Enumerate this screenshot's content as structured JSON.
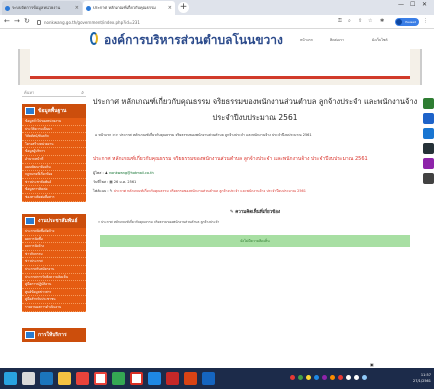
{
  "browser": {
    "tabs": [
      {
        "label": "ระบบจัดการข้อมูลหน่วยงาน"
      },
      {
        "label": "ประกาศ หลักเกณฑ์เกี่ยวกับคุณธรรม"
      }
    ],
    "url": "nonkwang.go.th/government/index.php?id=231",
    "profile_label": "Paused"
  },
  "site": {
    "title": "องค์การบริหารส่วนตำบลโนนขวาง",
    "nav": [
      "หน้าแรก",
      "ติดต่อเรา",
      "ผังเว็บไซต์"
    ]
  },
  "sidebar": {
    "search_placeholder": "ค้นหา",
    "box1": {
      "title": "ข้อมูลพื้นฐาน",
      "items": [
        "ข้อมูลทั่วไปของหน่วยงาน",
        "ประวัติความเป็นมา",
        "วิสัยทัศน์/พันธกิจ",
        "โครงสร้างหน่วยงาน",
        "ข้อมูลผู้บริหาร",
        "อำนาจหน้าที่",
        "แผนพัฒนาท้องถิ่น",
        "กฎหมายที่เกี่ยวข้อง",
        "ข่าวประชาสัมพันธ์",
        "ข้อมูลการติดต่อ",
        "ช่องทางติดต่อสื่อสาร"
      ]
    },
    "box2": {
      "title": "งานประชาสัมพันธ์",
      "items": [
        "ประกาศจัดซื้อจัดจ้าง",
        "ผลการจัดซื้อ",
        "ผลการจัดจ้าง",
        "ข่าวกิจกรรม",
        "ข่าวประกาศ",
        "ประกาศรับสมัครงาน",
        "ประกาศการรับฟังความคิดเห็น",
        "คู่มือการปฏิบัติงาน",
        "ศูนย์ข้อมูลข่าวสาร",
        "คู่มือสำหรับประชาชน",
        "รายงานผลการดำเนินงาน"
      ]
    },
    "box3": {
      "title": "การให้บริการ"
    }
  },
  "content": {
    "title": "ประกาศ หลักเกณฑ์เกี่ยวกับคุณธรรม จริยธรรมของพนักงานส่วนตำบล ลูกจ้างประจำ และพนักงานจ้าง ประจำปีงบประมาณ 2561",
    "breadcrumb": "หน้าแรก >> ประกาศ หลักเกณฑ์เกี่ยวกับคุณธรรม จริยธรรมของพนักงานส่วนตำบล ลูกจ้างประจำ และพนักงานจ้าง ประจำปีงบประมาณ 2561",
    "doc_line": "ประกาศ หลักเกณฑ์เกี่ยวกับคุณธรรม จริยธรรมของพนักงานส่วนตำบล ลูกจ้างประจำ และพนักงานจ้าง ประจำปีงบประมาณ 2561",
    "meta": {
      "by_label": "ผู้โพส :",
      "by_value": "nonkwang@hotmail.co.th",
      "date_label": "วันที่โพส :",
      "date_value": "26 ม.ค. 2561",
      "file_label": "ไฟล์แนบ :",
      "file_value": "ประกาศ หลักเกณฑ์เกี่ยวกับคุณธรรม จริยธรรมของพนักงานส่วนตำบล ลูกจ้างประจำ และพนักงานจ้าง ประจำปีงบประมาณ 2561"
    },
    "comments_head": "ความคิดเห็นที่เกี่ยวข้อง",
    "comment_row": "ประกาศ หลักเกณฑ์เกี่ยวกับคุณธรรม จริยธรรมของพนักงานส่วนตำบล ลูกจ้างประจำ",
    "green_bar": "ยังไม่มีความคิดเห็น"
  },
  "taskbar": {
    "time": "11:57",
    "date": "27/1/2561"
  },
  "colors": {
    "sidebar": "#e55c12",
    "taskbar": "#1c2b4a",
    "title": "#2b4a8b"
  }
}
